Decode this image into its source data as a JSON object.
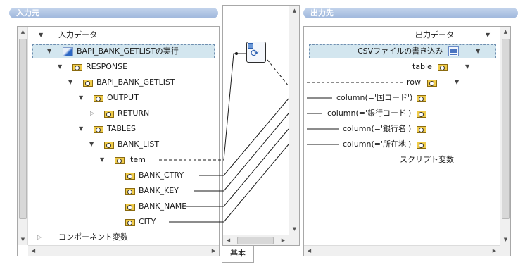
{
  "left_header": {
    "title": "入力元"
  },
  "right_header": {
    "title": "出力先"
  },
  "source_tree": {
    "root": "入力データ",
    "component": "BAPI_BANK_GETLISTの実行",
    "response": "RESPONSE",
    "bapi": "BAPI_BANK_GETLIST",
    "output": "OUTPUT",
    "return": "RETURN",
    "tables": "TABLES",
    "bank_list": "BANK_LIST",
    "item": "item",
    "bank_ctry": "BANK_CTRY",
    "bank_key": "BANK_KEY",
    "bank_name": "BANK_NAME",
    "city": "CITY",
    "component_vars": "コンポーネント変数"
  },
  "target_tree": {
    "root": "出力データ",
    "component": "CSVファイルの書き込み",
    "table": "table",
    "row": "row",
    "col1": "column(='国コード')",
    "col2": "column(='銀行コード')",
    "col3": "column(='銀行名')",
    "col4": "column(='所在地')",
    "script_vars": "スクリプト変数"
  },
  "mapping": {
    "tab_label": "基本",
    "function_icon": "mapping-function-icon"
  },
  "colors": {
    "header": "#a9bfe0",
    "selection": "#d3e6ef",
    "folder": "#f0cc4a"
  }
}
